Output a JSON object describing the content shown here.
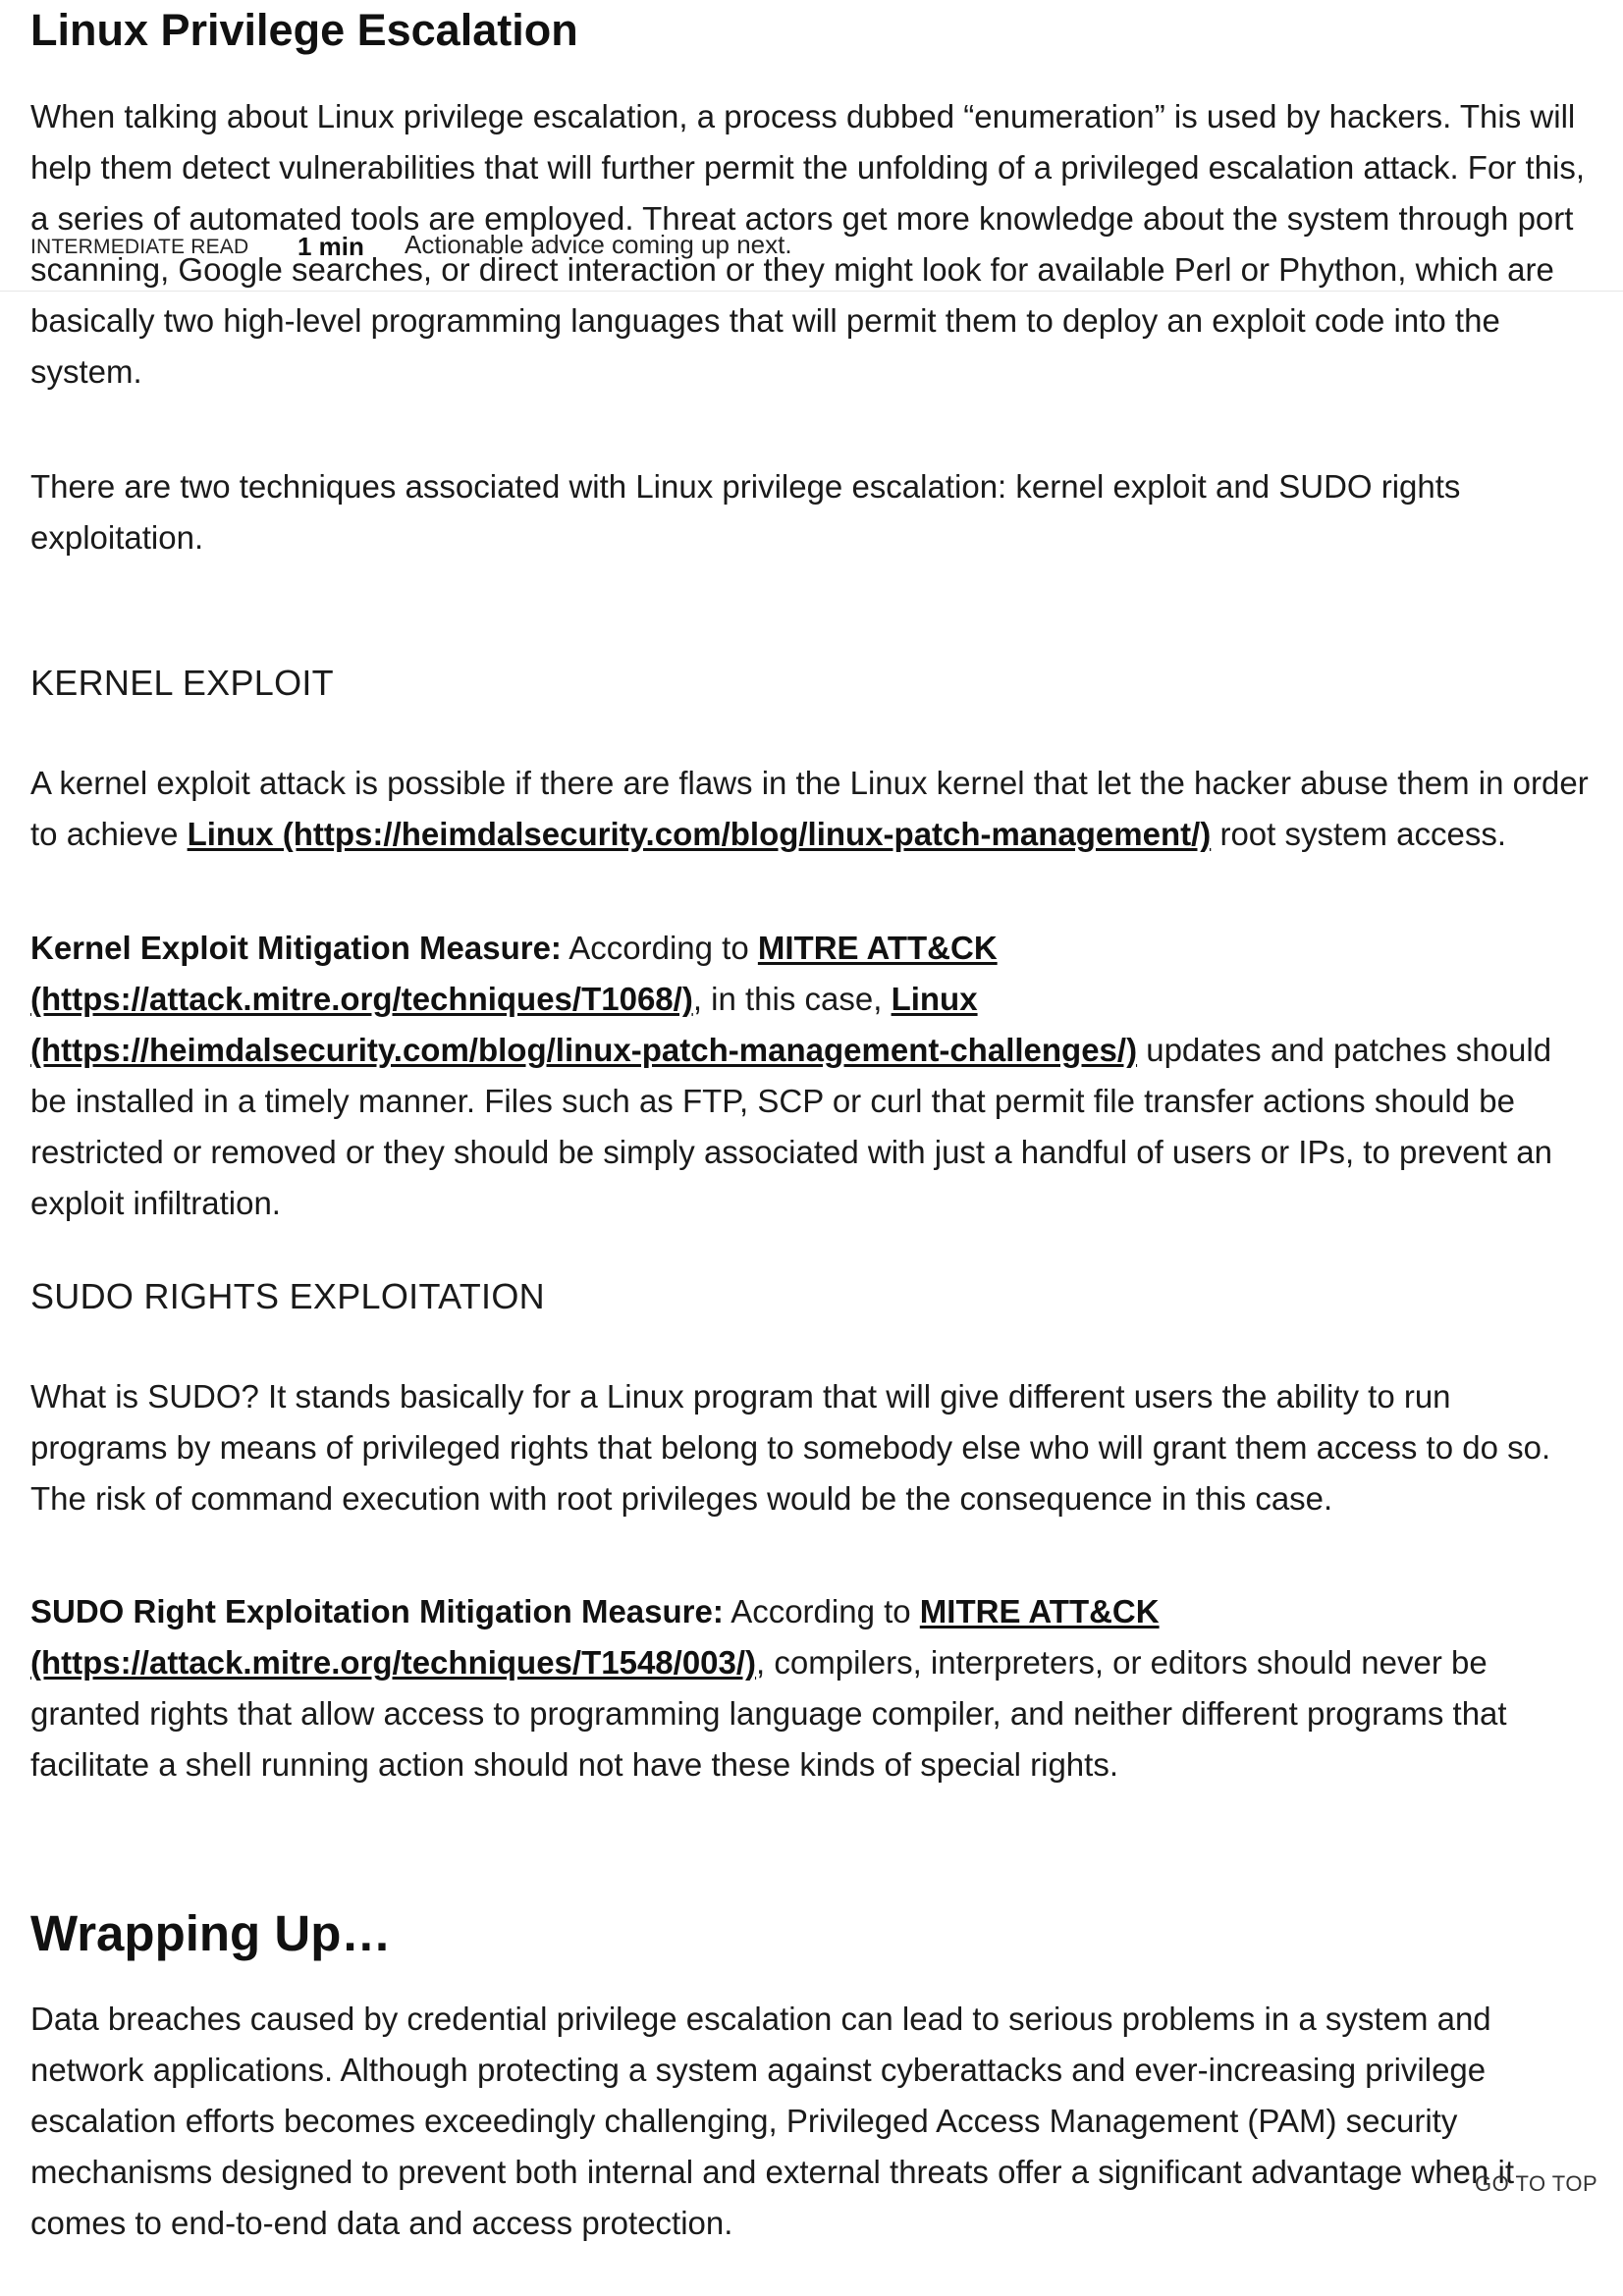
{
  "article": {
    "section_title": "Linux Privilege Escalation",
    "intro_p1": "When talking about Linux privilege escalation, a process dubbed “enumeration” is used by hackers. This will help them detect vulnerabilities that will further permit the unfolding of a privileged escalation attack. For this, a series of automated tools are employed. Threat actors get more knowledge about the system through port scanning, Google searches, or direct interaction or they might look for available Perl or Phython, which are basically two high-level programming languages that will permit them to deploy an exploit code into the system.",
    "intro_p2": "There are two techniques associated with Linux privilege escalation: kernel exploit and SUDO rights exploitation.",
    "kernel": {
      "heading": "KERNEL EXPLOIT",
      "p1_before": "A kernel exploit attack is possible if there are flaws in the Linux kernel that let the hacker abuse them in order to achieve ",
      "p1_link": "Linux (https://heimdalsecurity.com/blog/linux-patch-management/)",
      "p1_after": " root system access.",
      "mit_lead": "Kernel Exploit Mitigation Measure:",
      "mit_text1": " According to ",
      "mit_link1": "MITRE ATT&CK (https://attack.mitre.org/techniques/T1068/)",
      "mit_text2": ", in this case, ",
      "mit_link2": "Linux (https://heimdalsecurity.com/blog/linux-patch-management-challenges/)",
      "mit_text3": " updates and patches should be installed in a timely manner. Files such as FTP, SCP or curl that permit file transfer actions should be restricted or removed or they should be simply associated with just a handful of users or IPs, to prevent an exploit infiltration."
    },
    "sudo": {
      "heading": "SUDO RIGHTS EXPLOITATION",
      "p1": "What is SUDO? It stands basically for a Linux program that will give different users the ability to run programs by means of privileged rights that belong to somebody else who will grant them access to do so. The risk of command execution with root privileges would be the consequence in this case.",
      "mit_lead": "SUDO Right Exploitation Mitigation Measure:",
      "mit_text1": " According to ",
      "mit_link1": "MITRE ATT&CK (https://attack.mitre.org/techniques/T1548/003/)",
      "mit_text2": ", compilers, interpreters, or editors should never be granted rights that allow access to programming language compiler, and neither different programs that facilitate a shell running action should not have these kinds of special rights."
    },
    "wrap": {
      "heading": "Wrapping Up…",
      "p1": "Data breaches caused by credential privilege escalation can lead to serious problems in a system and network applications. Although protecting a system against cyberattacks and ever-increasing privilege escalation efforts becomes exceedingly challenging, Privileged Access Management (PAM) security mechanisms designed to prevent both internal and external threats offer a significant advantage when it comes to end-to-end data and access protection."
    }
  },
  "read_bar": {
    "level": "INTERMEDIATE READ",
    "time": "1 min",
    "note": "Actionable advice coming up next."
  },
  "go_top_label": "GO TO TOP"
}
